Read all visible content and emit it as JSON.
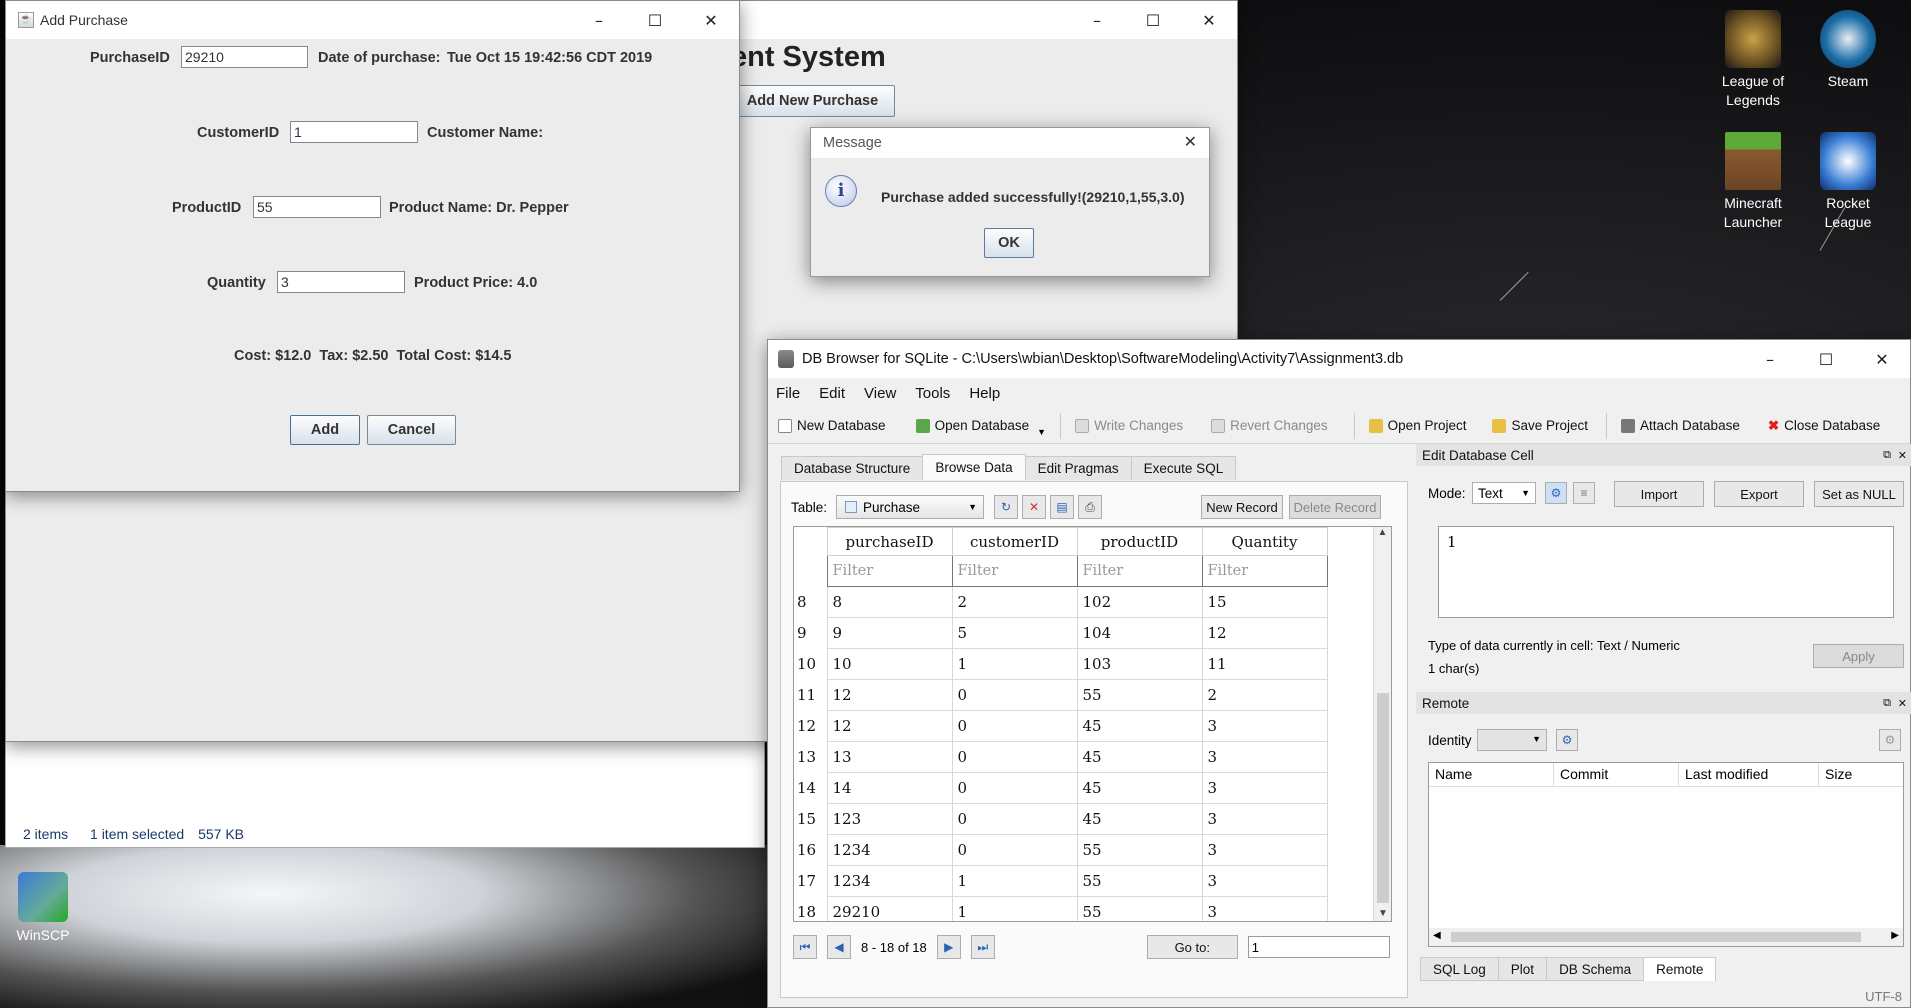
{
  "desktop": {
    "icons": [
      {
        "label_line1": "League of",
        "label_line2": "Legends"
      },
      {
        "label_line1": "Steam",
        "label_line2": ""
      },
      {
        "label_line1": "Minecraft",
        "label_line2": "Launcher"
      },
      {
        "label_line1": "Rocket",
        "label_line2": "League"
      },
      {
        "label_line1": "WinSCP",
        "label_line2": ""
      }
    ]
  },
  "main_window": {
    "title_fragment": "ent System",
    "button_label": "Add New Purchase"
  },
  "explorer_status": {
    "items": "2 items",
    "selected": "1 item selected",
    "size": "557 KB"
  },
  "add_purchase": {
    "title": "Add Purchase",
    "purchase_id_label": "PurchaseID",
    "purchase_id_value": "29210",
    "date_label": "Date of purchase:",
    "date_value": "Tue Oct 15 19:42:56 CDT 2019",
    "customer_id_label": "CustomerID",
    "customer_id_value": "1",
    "customer_name_label": "Customer Name:",
    "product_id_label": "ProductID",
    "product_id_value": "55",
    "product_name_label": "Product Name: Dr. Pepper",
    "quantity_label": "Quantity",
    "quantity_value": "3",
    "product_price_label": "Product Price: 4.0",
    "cost_line": "Cost: $12.0  Tax: $2.50  Total Cost: $14.5",
    "add_button": "Add",
    "cancel_button": "Cancel"
  },
  "message_dialog": {
    "title": "Message",
    "text": "Purchase added successfully!(29210,1,55,3.0)",
    "ok_button": "OK"
  },
  "db_browser": {
    "title": "DB Browser for SQLite - C:\\Users\\wbian\\Desktop\\SoftwareModeling\\Activity7\\Assignment3.db",
    "menu": [
      "File",
      "Edit",
      "View",
      "Tools",
      "Help"
    ],
    "toolbar": {
      "new_database": "New Database",
      "open_database": "Open Database",
      "write_changes": "Write Changes",
      "revert_changes": "Revert Changes",
      "open_project": "Open Project",
      "save_project": "Save Project",
      "attach_database": "Attach Database",
      "close_database": "Close Database"
    },
    "tabs": [
      "Database Structure",
      "Browse Data",
      "Edit Pragmas",
      "Execute SQL"
    ],
    "table_label": "Table:",
    "table_value": "Purchase",
    "new_record": "New Record",
    "delete_record": "Delete Record",
    "columns": [
      "purchaseID",
      "customerID",
      "productID",
      "Quantity"
    ],
    "filter_placeholder": "Filter",
    "rows": [
      {
        "n": "8",
        "c": [
          "8",
          "2",
          "102",
          "15"
        ]
      },
      {
        "n": "9",
        "c": [
          "9",
          "5",
          "104",
          "12"
        ]
      },
      {
        "n": "10",
        "c": [
          "10",
          "1",
          "103",
          "11"
        ]
      },
      {
        "n": "11",
        "c": [
          "12",
          "0",
          "55",
          "2"
        ]
      },
      {
        "n": "12",
        "c": [
          "12",
          "0",
          "45",
          "3"
        ]
      },
      {
        "n": "13",
        "c": [
          "13",
          "0",
          "45",
          "3"
        ]
      },
      {
        "n": "14",
        "c": [
          "14",
          "0",
          "45",
          "3"
        ]
      },
      {
        "n": "15",
        "c": [
          "123",
          "0",
          "45",
          "3"
        ]
      },
      {
        "n": "16",
        "c": [
          "1234",
          "0",
          "55",
          "3"
        ]
      },
      {
        "n": "17",
        "c": [
          "1234",
          "1",
          "55",
          "3"
        ]
      },
      {
        "n": "18",
        "c": [
          "29210",
          "1",
          "55",
          "3"
        ]
      }
    ],
    "pager_text": "8 - 18 of 18",
    "goto_label": "Go to:",
    "goto_value": "1",
    "edit_cell": {
      "title": "Edit Database Cell",
      "mode_label": "Mode:",
      "mode_value": "Text",
      "import": "Import",
      "export": "Export",
      "set_null": "Set as NULL",
      "cell_value": "1",
      "type_info": "Type of data currently in cell: Text / Numeric",
      "size_info": "1 char(s)",
      "apply": "Apply"
    },
    "remote": {
      "title": "Remote",
      "identity_label": "Identity",
      "columns": [
        "Name",
        "Commit",
        "Last modified",
        "Size"
      ]
    },
    "bottom_tabs": [
      "SQL Log",
      "Plot",
      "DB Schema",
      "Remote"
    ],
    "encoding": "UTF-8"
  }
}
